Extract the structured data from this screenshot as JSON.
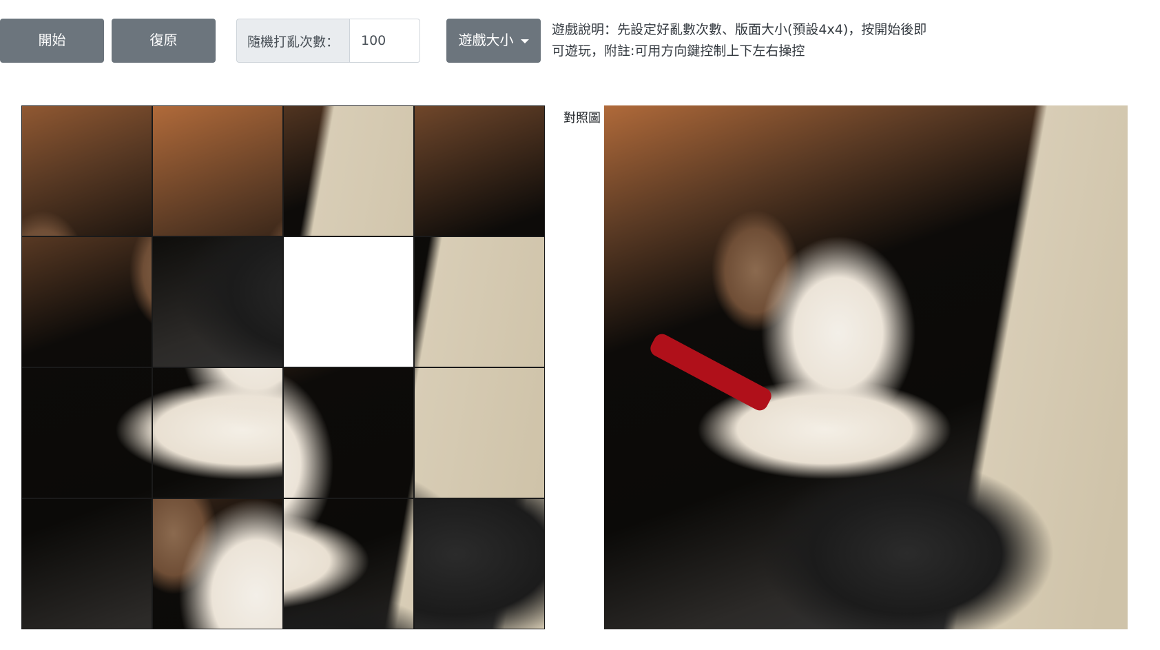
{
  "toolbar": {
    "start_label": "開始",
    "reset_label": "復原",
    "shuffle_prefix": "隨機打亂次數：",
    "shuffle_value": "100",
    "size_label": "遊戲大小"
  },
  "instructions": {
    "line1": "遊戲說明：先設定好亂數次數、版面大小(預設4x4)，按開始後即",
    "line2": "可遊玩，附註:可用方向鍵控制上下左右操控"
  },
  "board": {
    "grid": "4x4",
    "tiles": [
      {
        "piece": 2
      },
      {
        "piece": 1
      },
      {
        "piece": 4
      },
      {
        "piece": 3
      },
      {
        "piece": 5
      },
      {
        "piece": 14
      },
      {
        "piece": null
      },
      {
        "piece": 8
      },
      {
        "piece": 9
      },
      {
        "piece": 10
      },
      {
        "piece": 7
      },
      {
        "piece": 12
      },
      {
        "piece": 13
      },
      {
        "piece": 6
      },
      {
        "piece": 11
      },
      {
        "piece": 15
      }
    ]
  },
  "reference": {
    "label": "對照圖"
  }
}
